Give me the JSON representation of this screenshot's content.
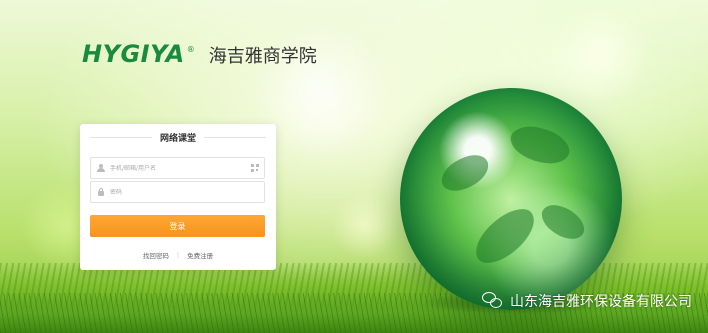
{
  "logo": {
    "brand": "HYGIYA",
    "registered_mark": "®",
    "school_name": "海吉雅商学院"
  },
  "login_card": {
    "title": "网络课堂",
    "username_placeholder": "手机/邮箱/用户名",
    "password_placeholder": "密码",
    "login_button": "登录",
    "forgot_password": "找回密码",
    "separator": "|",
    "register": "免费注册"
  },
  "watermark": {
    "text": "山东海吉雅环保设备有限公司"
  },
  "colors": {
    "brand_green": "#1a8a3c",
    "login_button": "#f7931e"
  }
}
